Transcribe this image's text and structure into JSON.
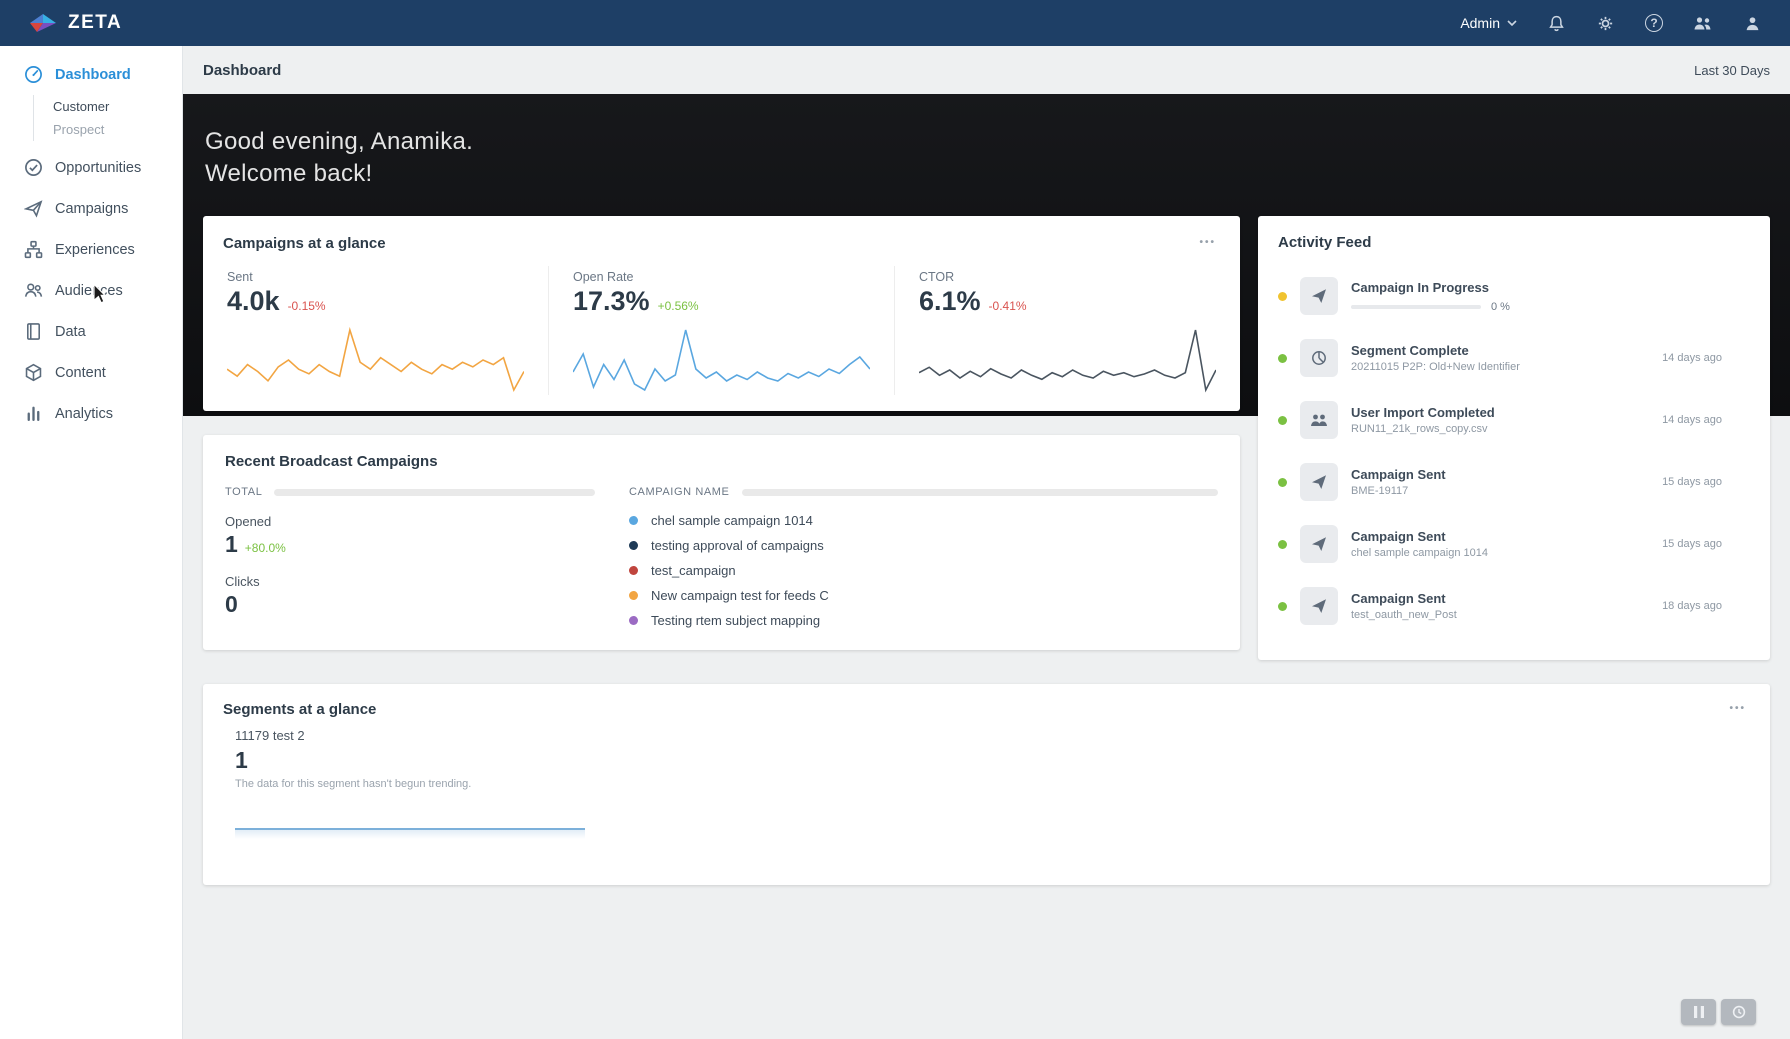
{
  "topbar": {
    "brand": "ZETA",
    "admin_label": "Admin"
  },
  "header": {
    "title": "Dashboard",
    "range": "Last 30 Days"
  },
  "hero": {
    "line1": "Good evening, Anamika.",
    "line2": "Welcome back!"
  },
  "colors": {
    "positive": "#7bc142",
    "negative": "#d9534f",
    "active_nav": "#2b8fd8"
  },
  "sidebar": {
    "items": [
      {
        "label": "Dashboard",
        "children": [
          "Customer",
          "Prospect"
        ]
      },
      {
        "label": "Opportunities"
      },
      {
        "label": "Campaigns"
      },
      {
        "label": "Experiences"
      },
      {
        "label": "Audiences"
      },
      {
        "label": "Data"
      },
      {
        "label": "Content"
      },
      {
        "label": "Analytics"
      }
    ]
  },
  "campaigns_glance": {
    "title": "Campaigns at a glance",
    "menu": "•••",
    "metrics": [
      {
        "label": "Sent",
        "value": "4.0k",
        "delta": "-0.15%",
        "trend": "down",
        "color": "#f2a542",
        "spark": [
          45,
          42,
          47,
          44,
          40,
          46,
          49,
          45,
          43,
          47,
          44,
          42,
          62,
          48,
          45,
          50,
          47,
          44,
          48,
          45,
          43,
          47,
          45,
          48,
          46,
          49,
          47,
          50,
          36,
          44
        ]
      },
      {
        "label": "Open Rate",
        "value": "17.3%",
        "delta": "+0.56%",
        "trend": "up",
        "color": "#5aa7e0",
        "spark": [
          50,
          62,
          40,
          55,
          45,
          58,
          42,
          38,
          52,
          44,
          48,
          78,
          52,
          46,
          50,
          44,
          48,
          45,
          50,
          46,
          44,
          49,
          46,
          50,
          47,
          52,
          49,
          55,
          60,
          52
        ]
      },
      {
        "label": "CTOR",
        "value": "6.1%",
        "delta": "-0.41%",
        "trend": "down",
        "color": "#4a5560",
        "spark": [
          48,
          52,
          46,
          50,
          44,
          49,
          45,
          51,
          47,
          44,
          50,
          46,
          43,
          48,
          45,
          50,
          46,
          44,
          49,
          46,
          48,
          45,
          47,
          50,
          46,
          44,
          48,
          80,
          35,
          50
        ]
      }
    ]
  },
  "broadcast": {
    "title": "Recent Broadcast Campaigns",
    "total_label": "TOTAL",
    "opened_label": "Opened",
    "opened_value": "1",
    "opened_delta": "+80.0%",
    "clicks_label": "Clicks",
    "clicks_value": "0",
    "name_label": "CAMPAIGN NAME",
    "campaigns": [
      {
        "name": "chel sample campaign 1014",
        "color": "#5aa7e0"
      },
      {
        "name": "testing approval of campaigns",
        "color": "#1f3b57"
      },
      {
        "name": "test_campaign",
        "color": "#c0453e"
      },
      {
        "name": "New campaign test for feeds C",
        "color": "#f2a542"
      },
      {
        "name": "Testing rtem subject mapping",
        "color": "#9b6bc3"
      }
    ]
  },
  "feed": {
    "title": "Activity Feed",
    "items": [
      {
        "title": "Campaign In Progress",
        "progress": "0 %",
        "status_color": "#f0c330"
      },
      {
        "title": "Segment Complete",
        "subtitle": "20211015 P2P: Old+New Identifier",
        "meta": "14 days ago",
        "status_color": "#7bc142"
      },
      {
        "title": "User Import Completed",
        "subtitle": "RUN11_21k_rows_copy.csv",
        "meta": "14 days ago",
        "status_color": "#7bc142"
      },
      {
        "title": "Campaign Sent",
        "subtitle": "BME-19117",
        "meta": "15 days ago",
        "status_color": "#7bc142"
      },
      {
        "title": "Campaign Sent",
        "subtitle": "chel sample campaign 1014",
        "meta": "15 days ago",
        "status_color": "#7bc142"
      },
      {
        "title": "Campaign Sent",
        "subtitle": "test_oauth_new_Post",
        "meta": "18 days ago",
        "status_color": "#7bc142"
      }
    ]
  },
  "segments": {
    "title": "Segments at a glance",
    "menu": "•••",
    "segment": {
      "name": "11179 test 2",
      "value": "1",
      "note": "The data for this segment hasn't begun trending."
    },
    "line_color": "#7cb0da"
  }
}
